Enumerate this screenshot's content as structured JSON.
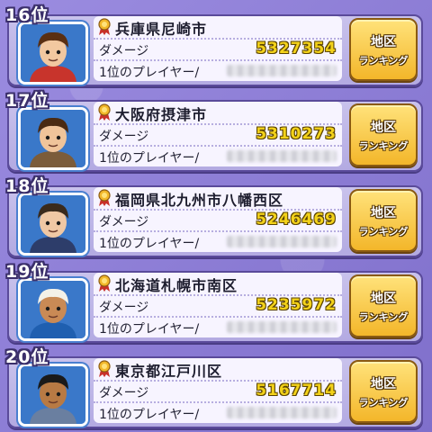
{
  "entries": [
    {
      "rank": "16位",
      "city": "兵庫県尼崎市",
      "damage_label": "ダメージ",
      "damage": "5327354",
      "player_label": "1位のプレイヤー/",
      "button_line1": "地区",
      "button_line2": "ランキング",
      "avatar_skin": "#f2c8a0",
      "avatar_hair": "#5a2f12",
      "avatar_shirt": "#c8342c"
    },
    {
      "rank": "17位",
      "city": "大阪府摂津市",
      "damage_label": "ダメージ",
      "damage": "5310273",
      "player_label": "1位のプレイヤー/",
      "button_line1": "地区",
      "button_line2": "ランキング",
      "avatar_skin": "#f0c49a",
      "avatar_hair": "#4a2a12",
      "avatar_shirt": "#7b5c3a"
    },
    {
      "rank": "18位",
      "city": "福岡県北九州市八幡西区",
      "damage_label": "ダメージ",
      "damage": "5246469",
      "player_label": "1位のプレイヤー/",
      "button_line1": "地区",
      "button_line2": "ランキング",
      "avatar_skin": "#f0c8a4",
      "avatar_hair": "#3a2a1c",
      "avatar_shirt": "#2d3d6a"
    },
    {
      "rank": "19位",
      "city": "北海道札幌市南区",
      "damage_label": "ダメージ",
      "damage": "5235972",
      "player_label": "1位のプレイヤー/",
      "button_line1": "地区",
      "button_line2": "ランキング",
      "avatar_skin": "#c98a55",
      "avatar_hair": "#f4f1e8",
      "avatar_shirt": "#1f5fb0"
    },
    {
      "rank": "20位",
      "city": "東京都江戸川区",
      "damage_label": "ダメージ",
      "damage": "5167714",
      "player_label": "1位のプレイヤー/",
      "button_line1": "地区",
      "button_line2": "ランキング",
      "avatar_skin": "#b87a44",
      "avatar_hair": "#1a1a1a",
      "avatar_shirt": "#6a7fa0"
    }
  ],
  "colors": {
    "background": "#8f80d6",
    "damage_text": "#f3d21a",
    "button": "#f3b62a",
    "avatar_bg": "#3a78c9"
  }
}
